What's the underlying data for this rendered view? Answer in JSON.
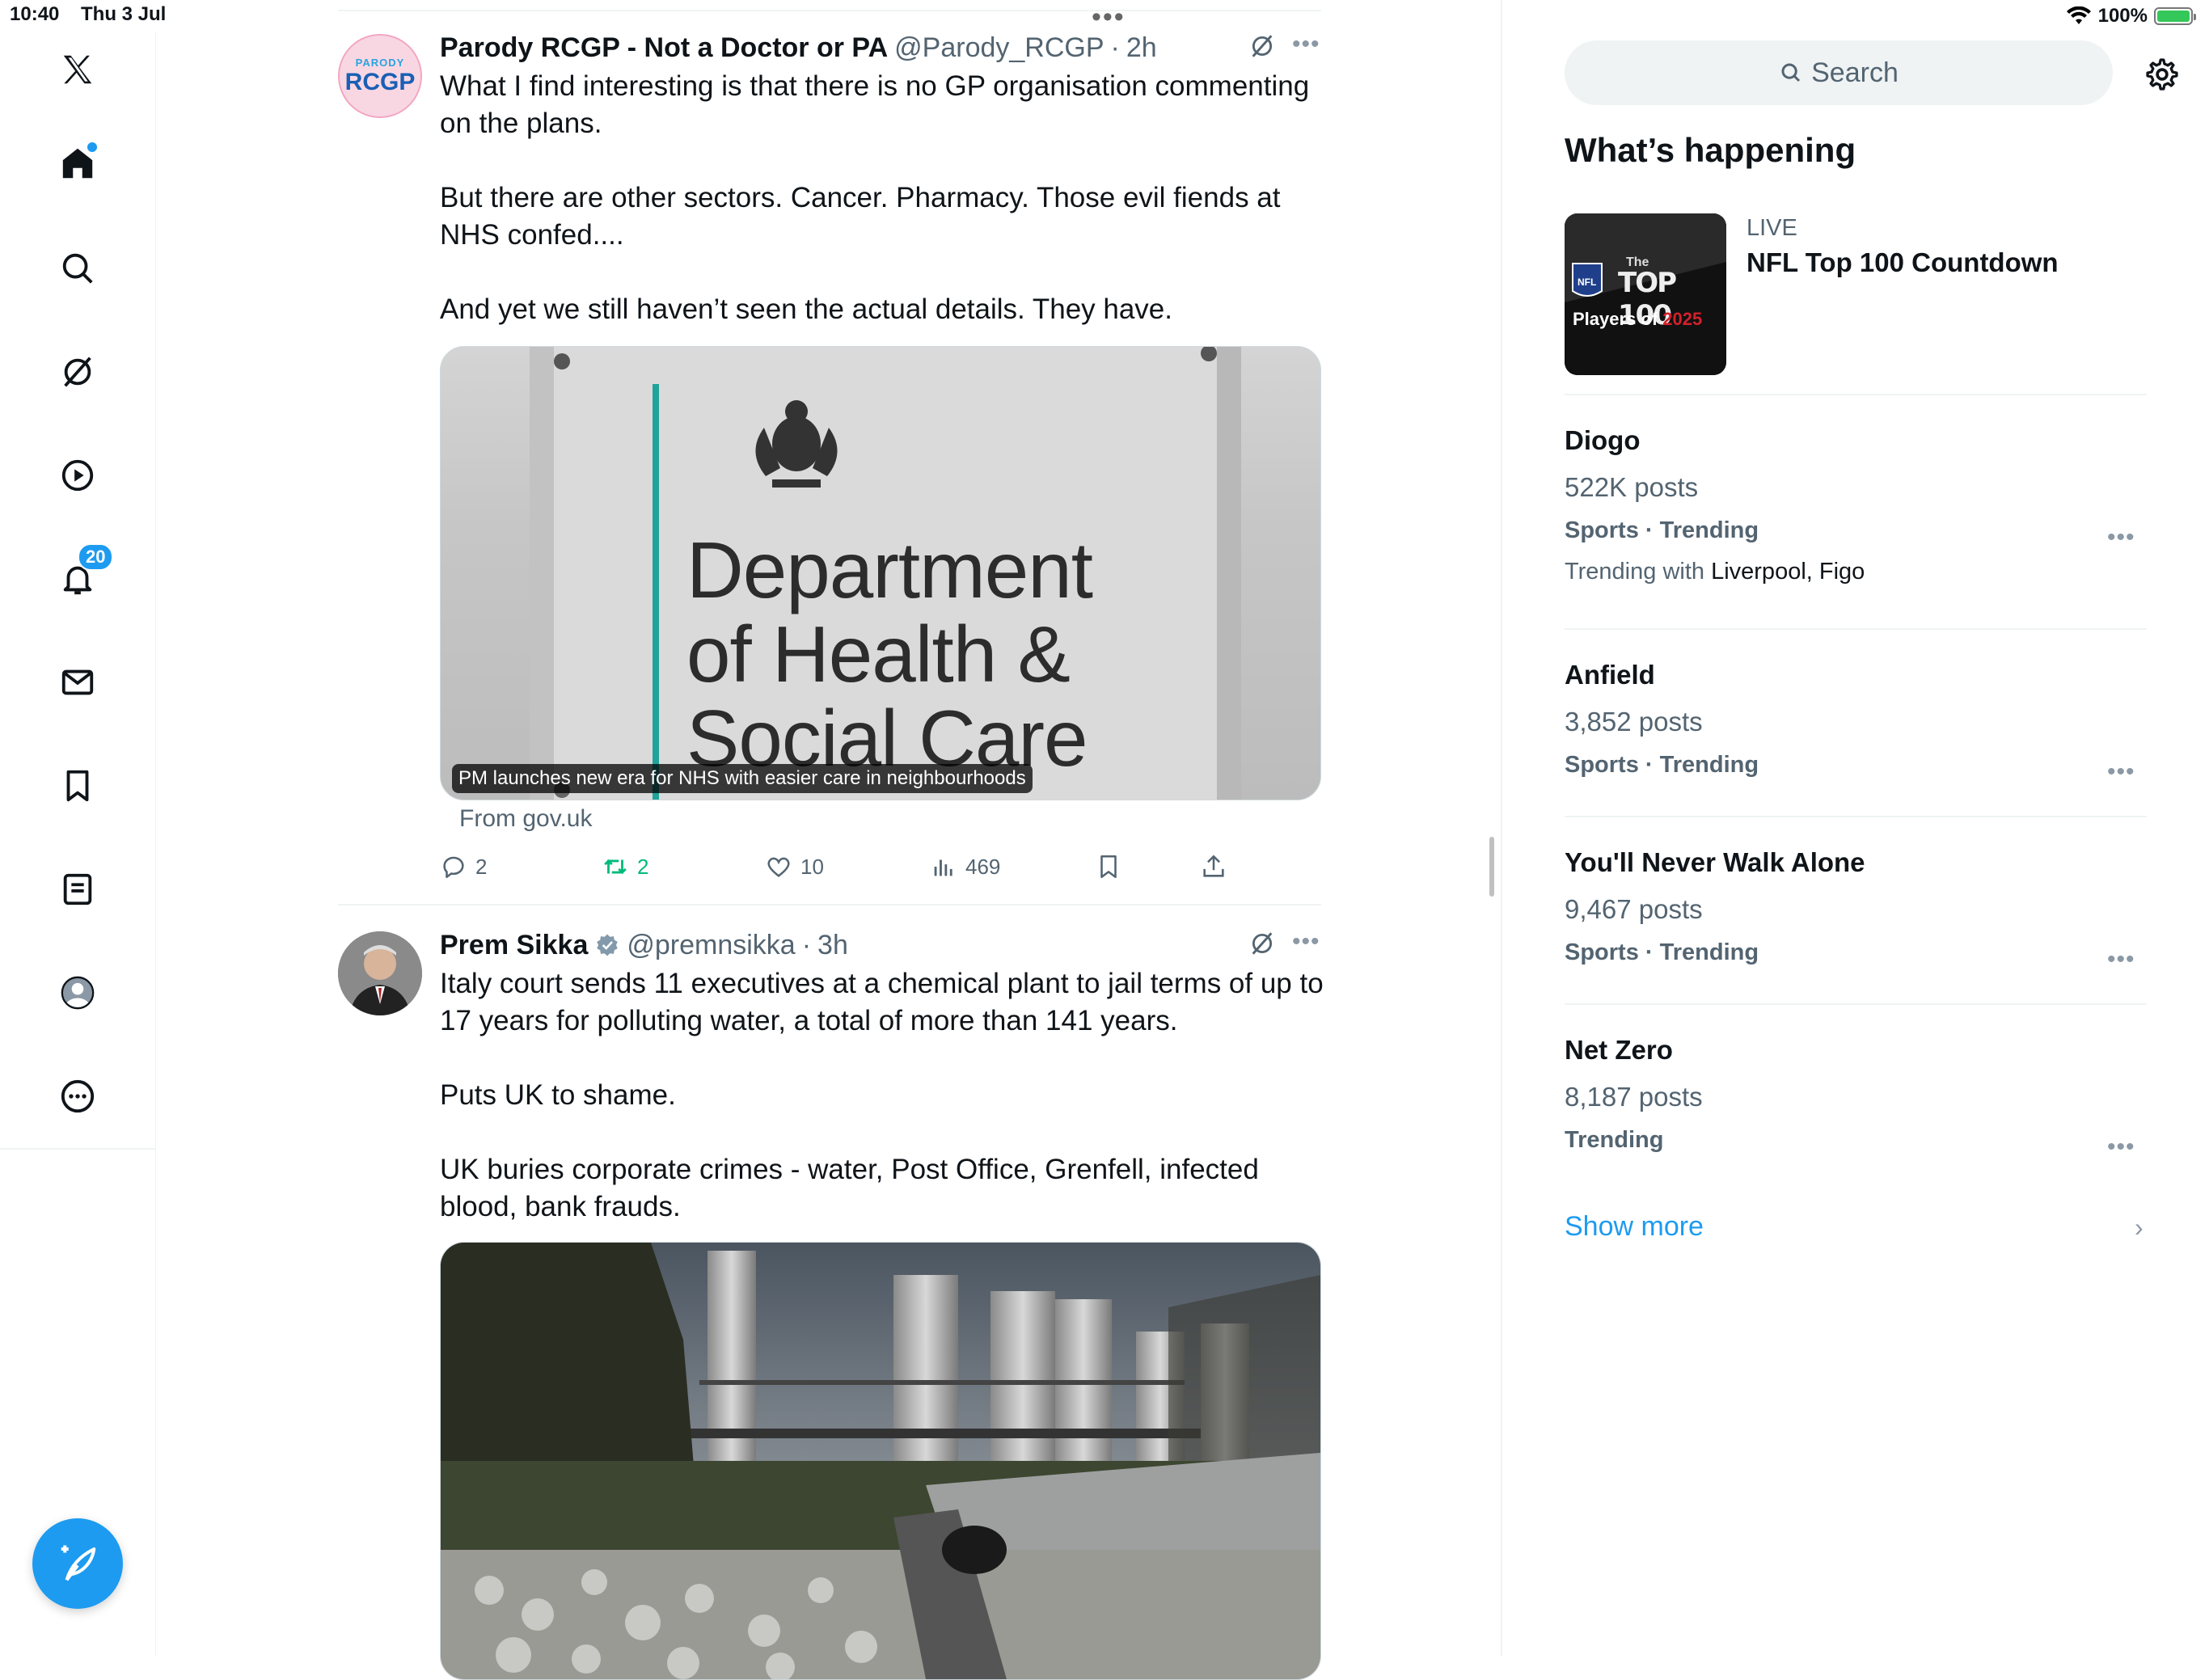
{
  "status_bar": {
    "time": "10:40",
    "date": "Thu 3 Jul",
    "battery": "100%"
  },
  "nav": {
    "notifications_badge": "20",
    "items": [
      "x-logo",
      "home",
      "explore",
      "grok",
      "video",
      "notifications",
      "messages",
      "bookmarks",
      "lists",
      "profile",
      "more"
    ]
  },
  "tweets": [
    {
      "name": "Parody RCGP - Not a Doctor or PA",
      "handle": "@Parody_RCGP",
      "sep": "·",
      "time": "2h",
      "avatar_top": "PARODY",
      "avatar_main": "RCGP",
      "paragraphs": [
        "What I find interesting is that there is no GP organisation commenting on the plans.",
        "But there are other sectors. Cancer. Pharmacy. Those evil fiends at NHS confed....",
        "And yet we still haven’t seen the actual details. They have."
      ],
      "card": {
        "sign_lines": [
          "Department",
          "of Health &",
          "Social Care"
        ],
        "caption": "PM launches new era for NHS with easier care in neighbourhoods",
        "from": "From gov.uk"
      },
      "stats": {
        "replies": "2",
        "reposts": "2",
        "likes": "10",
        "views": "469"
      }
    },
    {
      "name": "Prem Sikka",
      "handle": "@premnsikka",
      "sep": "·",
      "time": "3h",
      "paragraphs": [
        "Italy court sends 11 executives at a chemical plant to jail terms of up to 17 years for polluting water, a total of more than 141 years.",
        "Puts UK to shame.",
        "UK buries corporate crimes - water, Post Office, Grenfell, infected blood, bank frauds."
      ]
    }
  ],
  "right": {
    "search_placeholder": "Search",
    "title": "What’s happening",
    "live": {
      "label": "LIVE",
      "title": "NFL Top 100 Countdown",
      "thumb_top": "The",
      "thumb_main": "TOP 100",
      "thumb_players": "Players of",
      "thumb_year": "2025",
      "thumb_nfl": "NFL"
    },
    "trends": [
      {
        "name": "Diogo",
        "posts": "522K posts",
        "category": "Sports · Trending",
        "with_label": "Trending with",
        "with_names": "Liverpool, Figo"
      },
      {
        "name": "Anfield",
        "posts": "3,852 posts",
        "category": "Sports · Trending"
      },
      {
        "name": "You'll Never Walk Alone",
        "posts": "9,467 posts",
        "category": "Sports · Trending"
      },
      {
        "name": "Net Zero",
        "posts": "8,187 posts",
        "category": "Trending"
      }
    ],
    "show_more": "Show more"
  },
  "colors": {
    "accent": "#1d9bf0",
    "retweet_green": "#00ba7c",
    "text": "#0f1419",
    "secondary": "#536471"
  }
}
